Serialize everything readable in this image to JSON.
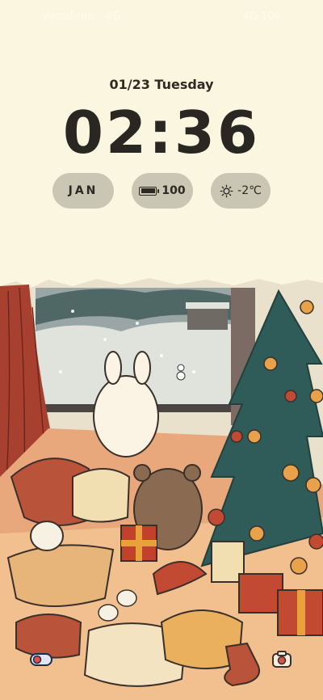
{
  "status_bar": {
    "left": "Vodafone · 4G",
    "right": "4G 100"
  },
  "lock": {
    "date": "01/23 Tuesday",
    "time": "02:36"
  },
  "widgets": {
    "month": "JAN",
    "battery": "100",
    "weather": "-2℃"
  },
  "icons": {
    "battery": "battery-icon",
    "weather": "sun-icon",
    "flashlight": "flashlight-icon",
    "camera": "camera-icon"
  },
  "colors": {
    "background": "#fbf6df",
    "pill": "#c9c6b4",
    "text": "#2a2622"
  }
}
